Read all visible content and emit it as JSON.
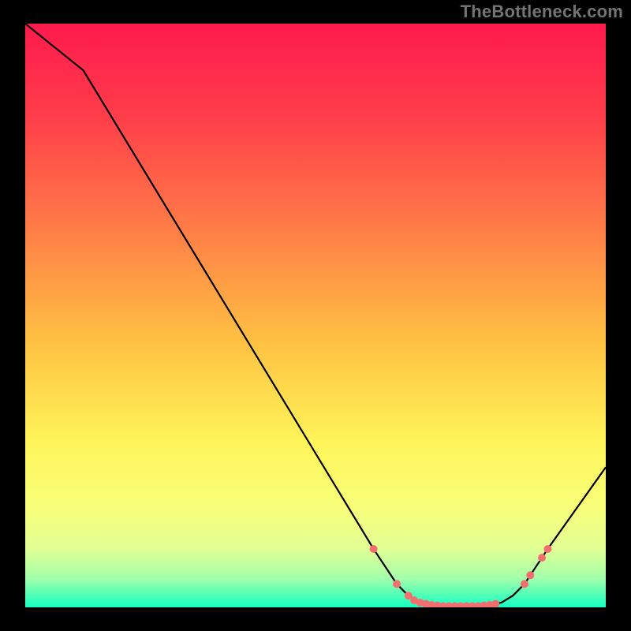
{
  "attribution": "TheBottleneck.com",
  "chart_data": {
    "type": "line",
    "title": "",
    "xlabel": "",
    "ylabel": "",
    "xlim": [
      0,
      100
    ],
    "ylim": [
      0,
      100
    ],
    "x": [
      0,
      10,
      60,
      64,
      66,
      68,
      70,
      72,
      74,
      76,
      78,
      80,
      82,
      84,
      86,
      88,
      90,
      100
    ],
    "values": [
      100,
      92,
      10,
      4,
      2,
      0.8,
      0.4,
      0.2,
      0.2,
      0.2,
      0.2,
      0.4,
      0.8,
      2,
      4,
      7,
      10,
      24
    ],
    "marker_points": [
      {
        "x": 60,
        "y": 10
      },
      {
        "x": 64,
        "y": 4
      },
      {
        "x": 66,
        "y": 2
      },
      {
        "x": 67,
        "y": 1.2
      },
      {
        "x": 68,
        "y": 0.8
      },
      {
        "x": 69,
        "y": 0.6
      },
      {
        "x": 70,
        "y": 0.4
      },
      {
        "x": 71,
        "y": 0.3
      },
      {
        "x": 72,
        "y": 0.2
      },
      {
        "x": 73,
        "y": 0.2
      },
      {
        "x": 74,
        "y": 0.2
      },
      {
        "x": 75,
        "y": 0.2
      },
      {
        "x": 76,
        "y": 0.2
      },
      {
        "x": 77,
        "y": 0.2
      },
      {
        "x": 78,
        "y": 0.2
      },
      {
        "x": 79,
        "y": 0.3
      },
      {
        "x": 80,
        "y": 0.4
      },
      {
        "x": 81,
        "y": 0.6
      },
      {
        "x": 86,
        "y": 4
      },
      {
        "x": 87,
        "y": 5.5
      },
      {
        "x": 89,
        "y": 8.5
      },
      {
        "x": 90,
        "y": 10
      }
    ],
    "gradient_stops": [
      {
        "offset": 0.0,
        "color": "#ff1a4d"
      },
      {
        "offset": 0.15,
        "color": "#ff3b4a"
      },
      {
        "offset": 0.35,
        "color": "#ff7c47"
      },
      {
        "offset": 0.55,
        "color": "#ffc342"
      },
      {
        "offset": 0.72,
        "color": "#fff55a"
      },
      {
        "offset": 0.83,
        "color": "#f8ff7a"
      },
      {
        "offset": 0.9,
        "color": "#e0ff94"
      },
      {
        "offset": 0.95,
        "color": "#a4ffab"
      },
      {
        "offset": 0.975,
        "color": "#5cffb5"
      },
      {
        "offset": 1.0,
        "color": "#14ffc2"
      }
    ],
    "marker_color": "#f36f6f",
    "curve_color": "#000000"
  }
}
